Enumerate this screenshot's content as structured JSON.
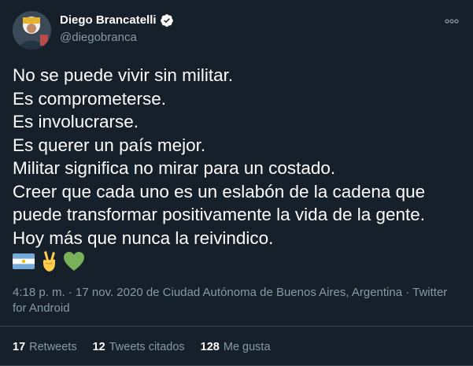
{
  "author": {
    "name": "Diego Brancatelli",
    "handle": "@diegobranca",
    "verified": true
  },
  "tweet": {
    "lines": [
      "No se puede vivir sin militar.",
      "Es comprometerse.",
      "Es involucrarse.",
      "Es querer un país mejor.",
      "Militar significa no mirar para un costado.",
      "Creer que cada uno es un eslabón de la cadena que",
      "puede transformar positivamente la vida de la gente.",
      "Hoy más que nunca la reivindico."
    ],
    "emojis": [
      "argentina-flag-icon",
      "victory-hand-icon",
      "green-heart-icon"
    ]
  },
  "meta": {
    "line1": "4:18 p. m. · 17 nov. 2020 de Ciudad Autónoma de Buenos Aires, Argentina · Twitter",
    "line2": "for Android"
  },
  "stats": {
    "retweets": {
      "count": "17",
      "label": "Retweets"
    },
    "quotes": {
      "count": "12",
      "label": "Tweets citados"
    },
    "likes": {
      "count": "128",
      "label": "Me gusta"
    }
  },
  "colors": {
    "background": "#15202b",
    "text": "#ffffff",
    "secondary": "#8899a6",
    "divider": "#38444d",
    "verified": "#ffffff"
  }
}
